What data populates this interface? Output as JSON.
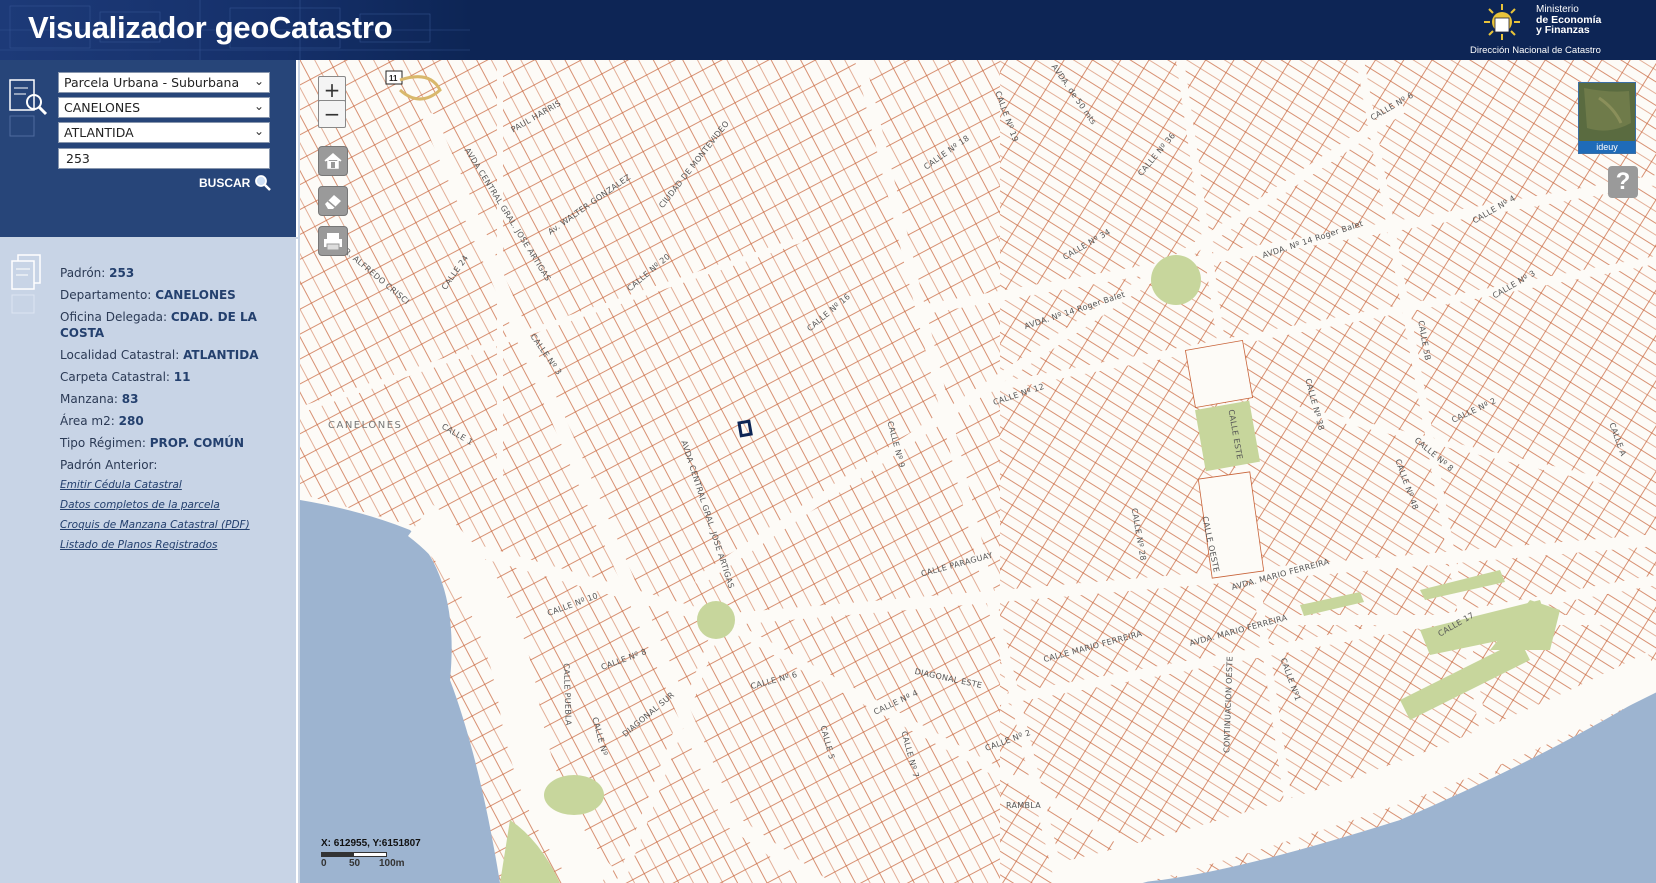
{
  "header": {
    "title": "Visualizador geoCatastro",
    "logo": {
      "ministry_line1": "Ministerio",
      "ministry_line2": "de Economía",
      "ministry_line3": "y Finanzas",
      "subtitle": "Dirección Nacional de Catastro"
    }
  },
  "search": {
    "type_selected": "Parcela Urbana - Suburbana",
    "department_selected": "CANELONES",
    "locality_selected": "ATLANTIDA",
    "padron_value": "253",
    "button_label": "BUSCAR"
  },
  "info": {
    "padron_label": "Padrón:",
    "padron_value": "253",
    "depto_label": "Departamento:",
    "depto_value": "CANELONES",
    "oficina_label": "Oficina Delegada:",
    "oficina_value": "CDAD. DE LA COSTA",
    "localidad_label": "Localidad Catastral:",
    "localidad_value": "ATLANTIDA",
    "carpeta_label": "Carpeta Catastral:",
    "carpeta_value": "11",
    "manzana_label": "Manzana:",
    "manzana_value": "83",
    "area_label": "Área m2:",
    "area_value": "280",
    "regimen_label": "Tipo Régimen:",
    "regimen_value": "PROP. COMÚN",
    "anterior_label": "Padrón Anterior:",
    "links": [
      "Emitir Cédula Catastral",
      "Datos completos de la parcela",
      "Croquis de Manzana Catastral (PDF)",
      "Listado de Planos Registrados"
    ]
  },
  "map": {
    "zoom_in": "+",
    "zoom_out": "−",
    "help": "?",
    "basemap_label": "ideuy",
    "coords": "X: 612955, Y:6151807",
    "scale_labels": [
      "0",
      "50",
      "100m"
    ],
    "route_shield": "11",
    "labels": {
      "canelones": "CANELONES",
      "paul_harris": "PAUL HARRIS",
      "avda_central": "AVDA CENTRAL GRAL. JOSE ARTIGAS",
      "avda_central2": "AVDA CENTRAL GRAL. JOSE ARTIGAS",
      "ciudad_mvd": "CIUDAD DE MONTEVIDEO",
      "walter": "Av. WALTER GONZALEZ",
      "alfredo": "DR. ALFREDO CRISCI",
      "calle24": "CALLE 24",
      "calle3": "CALLE Nº 3",
      "calle1": "CALLE 1",
      "calle20": "CALLE Nº 20",
      "calle16": "CALLE Nº 16",
      "calle18": "CALLE Nº 18",
      "calle19": "CALLE Nº 19",
      "avda50": "AVDA. de 50 mts",
      "calle36": "CALLE Nº 36",
      "calle34": "CALLE Nº 34",
      "calle6": "CALLE Nº 6",
      "calle4": "CALLE Nº 4",
      "roger1": "AVDA. Nº 14 Roger Balet",
      "roger2": "AVDA. Nº 14 Roger Balet",
      "calle12": "CALLE Nº 12",
      "calle9": "CALLE Nº 9",
      "calleEste": "CALLE ESTE",
      "calle38": "CALLE Nº 38",
      "calle2": "CALLE Nº 2",
      "calle8": "CALLE Nº 8",
      "calle48": "CALLE Nº 48",
      "callea": "CALLE A",
      "paraguay": "CALLE PARAGUAY",
      "calle28": "CALLE Nº 28",
      "calleOeste": "CALLE OESTE",
      "mario1": "AVDA. MARIO FERREIRA",
      "mario2": "CALLE MARIO FERREIRA",
      "mario3": "AVDA. MARIO FERREIRA",
      "calle10": "CALLE Nº 10",
      "calle8b": "CALLE Nº 8",
      "diagonalSur": "DIAGONAL SUR",
      "diagonalEste": "DIAGONAL ESTE",
      "calle6b": "CALLE Nº 6",
      "calle5": "CALLE 5",
      "calle4b": "CALLE Nº 4",
      "calle7": "CALLE Nº 7",
      "calle2b": "CALLE Nº 2",
      "rambla": "RAMBLA",
      "continuacion": "CONTINUACION OESTE",
      "calle17": "CALLE 17",
      "calle1b": "CALLE Nº1",
      "calle3b": "CALLE Nº 3",
      "calle5b": "CALLE 5B",
      "puebla": "CALLE PUEBLA",
      "calle_n": "CALLE Nº"
    }
  }
}
